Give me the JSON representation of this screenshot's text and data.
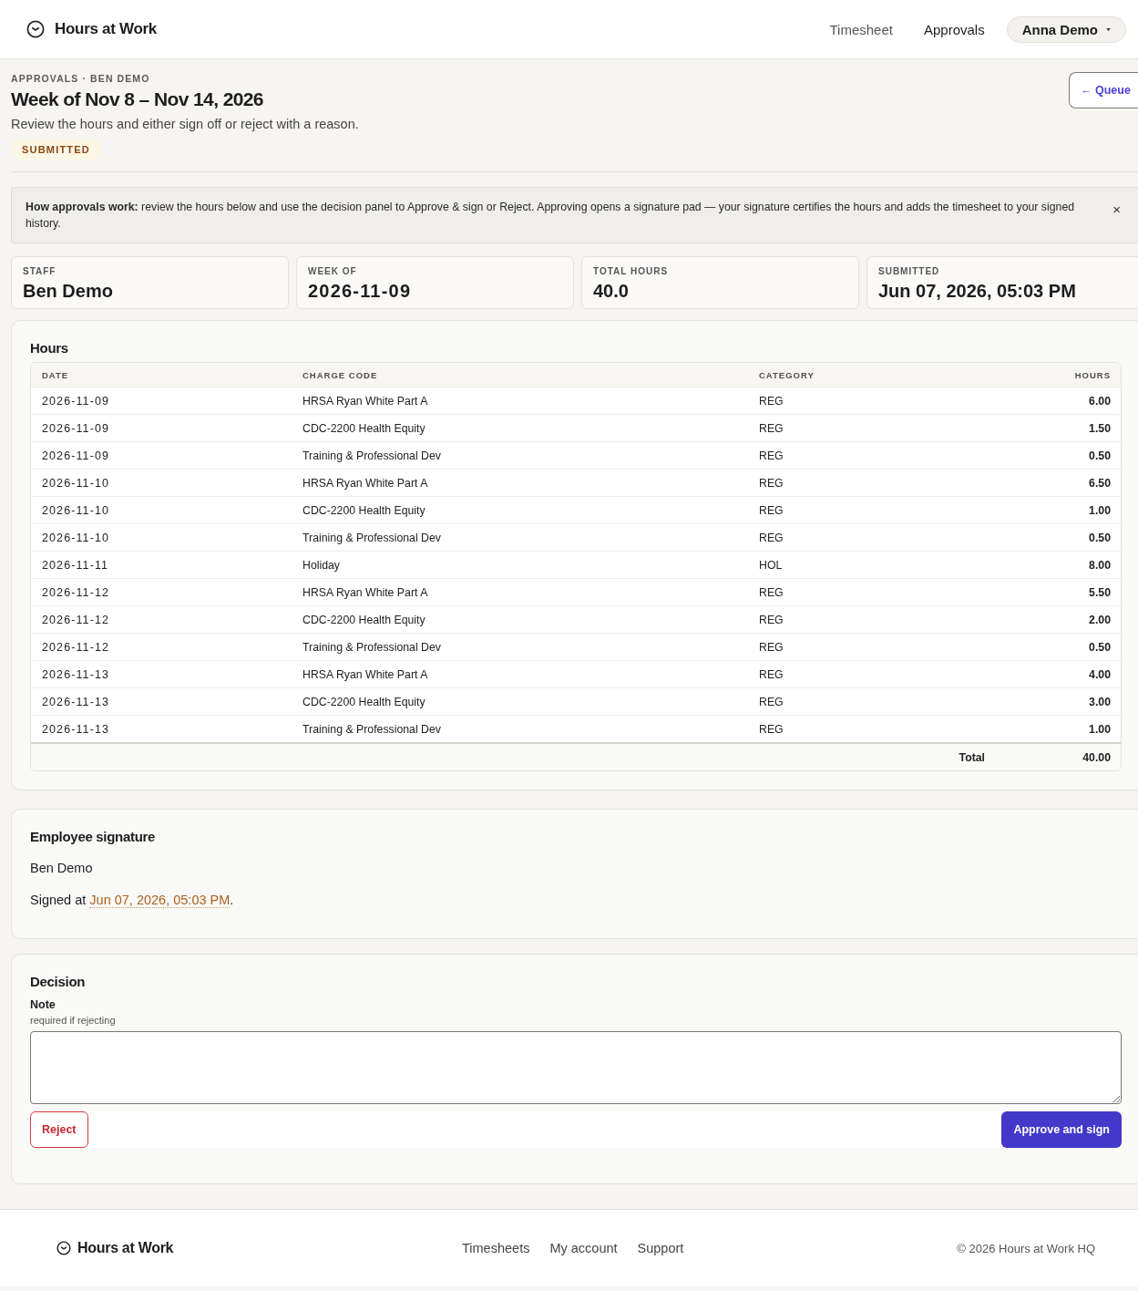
{
  "header": {
    "brand": "Hours at Work",
    "nav": [
      {
        "label": "Timesheet",
        "selected": false
      },
      {
        "label": "Approvals",
        "selected": true
      }
    ],
    "user_menu": {
      "label": "Anna Demo"
    }
  },
  "page": {
    "breadcrumb": "APPROVALS · BEN DEMO",
    "title": "Week of Nov 8 – Nov 14, 2026",
    "subtitle": "Review the hours and either sign off or reject with a reason.",
    "status": "SUBMITTED",
    "back_button": "← Queue"
  },
  "notice": {
    "text": "**How approvals work:** review the hours below and use the decision panel to Approve & sign or Reject. Approving opens a signature pad — your signature certifies the hours and adds the timesheet to your signed history.",
    "close": "×"
  },
  "stats": [
    {
      "label": "STAFF",
      "value": "Ben Demo"
    },
    {
      "label": "WEEK OF",
      "value": "2026-11-09"
    },
    {
      "label": "TOTAL HOURS",
      "value": "40.0"
    },
    {
      "label": "SUBMITTED",
      "value": "Jun 07, 2026, 05:03 PM"
    }
  ],
  "hours": {
    "title": "Hours",
    "columns": [
      "DATE",
      "CHARGE CODE",
      "CATEGORY",
      "HOURS"
    ],
    "rows": [
      {
        "date": "2026-11-09",
        "charge_code": "HRSA Ryan White Part A",
        "category": "REG",
        "hours": "6.00"
      },
      {
        "date": "2026-11-09",
        "charge_code": "CDC-2200 Health Equity",
        "category": "REG",
        "hours": "1.50"
      },
      {
        "date": "2026-11-09",
        "charge_code": "Training & Professional Dev",
        "category": "REG",
        "hours": "0.50"
      },
      {
        "date": "2026-11-10",
        "charge_code": "HRSA Ryan White Part A",
        "category": "REG",
        "hours": "6.50"
      },
      {
        "date": "2026-11-10",
        "charge_code": "CDC-2200 Health Equity",
        "category": "REG",
        "hours": "1.00"
      },
      {
        "date": "2026-11-10",
        "charge_code": "Training & Professional Dev",
        "category": "REG",
        "hours": "0.50"
      },
      {
        "date": "2026-11-11",
        "charge_code": "Holiday",
        "category": "HOL",
        "hours": "8.00"
      },
      {
        "date": "2026-11-12",
        "charge_code": "HRSA Ryan White Part A",
        "category": "REG",
        "hours": "5.50"
      },
      {
        "date": "2026-11-12",
        "charge_code": "CDC-2200 Health Equity",
        "category": "REG",
        "hours": "2.00"
      },
      {
        "date": "2026-11-12",
        "charge_code": "Training & Professional Dev",
        "category": "REG",
        "hours": "0.50"
      },
      {
        "date": "2026-11-13",
        "charge_code": "HRSA Ryan White Part A",
        "category": "REG",
        "hours": "4.00"
      },
      {
        "date": "2026-11-13",
        "charge_code": "CDC-2200 Health Equity",
        "category": "REG",
        "hours": "3.00"
      },
      {
        "date": "2026-11-13",
        "charge_code": "Training & Professional Dev",
        "category": "REG",
        "hours": "1.00"
      }
    ],
    "total_label": "Total",
    "total": "40.00"
  },
  "signature": {
    "title": "Employee signature",
    "name": "Ben Demo",
    "signed": {
      "prefix": "Signed at",
      "time": "Jun 07, 2026, 05:03 PM",
      "suffix": "."
    }
  },
  "decision": {
    "title": "Decision",
    "note_label": "Note",
    "note_hint": "required if rejecting",
    "reject": "Reject",
    "approve": "Approve and sign"
  },
  "footer": {
    "brand": "Hours at Work",
    "links": [
      "Timesheets",
      "My account",
      "Support"
    ],
    "copyright": "© 2026 Hours at Work HQ"
  }
}
